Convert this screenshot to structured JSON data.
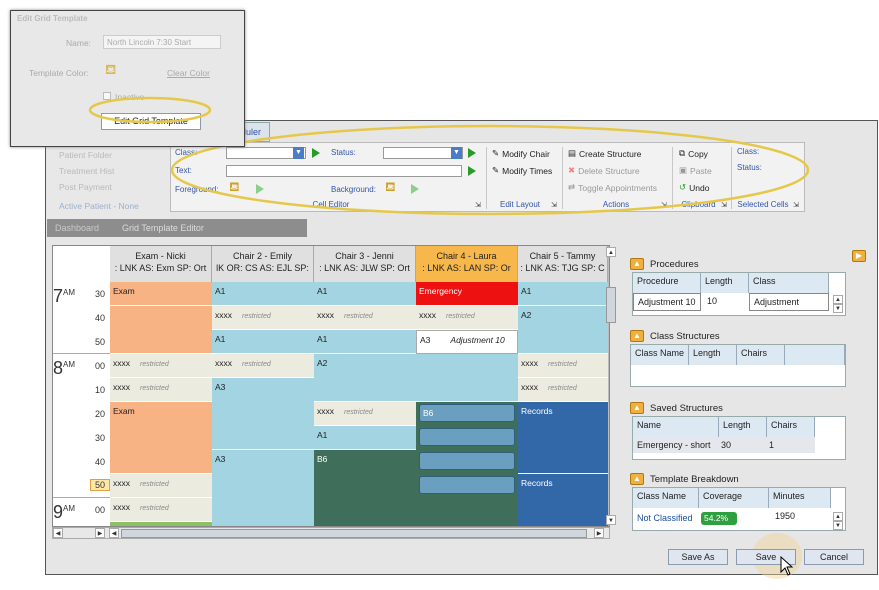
{
  "popup": {
    "title": "Edit Grid Template",
    "name_label": "Name:",
    "name_value": "North Lincoln 7:30 Start",
    "color_label": "Template Color:",
    "clear_color": "Clear Color",
    "inactive_label": "Inactive",
    "button": "Edit Grid Template"
  },
  "tab_scheduler": "duler",
  "left_faded": {
    "items": [
      "Patient Folder",
      "Treatment Hist",
      "Post Payment"
    ],
    "active_patient": "Active Patient - None",
    "tabs": [
      "Dashboard",
      "Grid Template Editor"
    ]
  },
  "ribbon": {
    "class_label": "Class:",
    "status_label": "Status:",
    "text_label": "Text:",
    "foreground_label": "Foreground:",
    "background_label": "Background:",
    "cell_editor": "Cell Editor",
    "modify_chair": "Modify Chair",
    "modify_times": "Modify Times",
    "edit_layout": "Edit Layout",
    "create_structure": "Create Structure",
    "delete_structure": "Delete Structure",
    "toggle_appointments": "Toggle Appointments",
    "actions": "Actions",
    "copy": "Copy",
    "paste": "Paste",
    "undo": "Undo",
    "clipboard": "Clipboard",
    "sc_class": "Class:",
    "sc_status": "Status:",
    "selected_cells": "Selected Cells"
  },
  "grid": {
    "columns": [
      {
        "name": "Exam - Nicki",
        "sub": ": LNK  AS: Exm  SP: Ort"
      },
      {
        "name": "Chair 2 - Emily",
        "sub": "lK  OR: CS  AS: EJL  SP:"
      },
      {
        "name": "Chair 3 - Jenni",
        "sub": ": LNK  AS: JLW  SP: Ort"
      },
      {
        "name": "Chair 4 - Laura",
        "sub": ": LNK  AS: LAN  SP: Or"
      },
      {
        "name": "Chair 5 - Tammy",
        "sub": ": LNK  AS: TJG  SP: C"
      }
    ],
    "hours": [
      {
        "h": "7",
        "ap": "AM"
      },
      {
        "h": "8",
        "ap": "AM"
      },
      {
        "h": "9",
        "ap": "AM"
      }
    ],
    "minutes": [
      "30",
      "40",
      "50",
      "00",
      "10",
      "20",
      "30",
      "40",
      "50",
      "00"
    ],
    "restricted": "restricted",
    "xxxx": "xxxx",
    "labels": {
      "exam": "Exam",
      "a1": "A1",
      "a2": "A2",
      "a3": "A3",
      "b6": "B6",
      "emergency": "Emergency",
      "records": "Records",
      "adjustment": "Adjustment 10"
    }
  },
  "procedures": {
    "title": "Procedures",
    "headers": [
      "Procedure",
      "Length",
      "Class"
    ],
    "row": [
      "Adjustment 10",
      "10",
      "Adjustment"
    ]
  },
  "class_structures": {
    "title": "Class Structures",
    "headers": [
      "Class Name",
      "Length",
      "Chairs"
    ]
  },
  "saved_structures": {
    "title": "Saved Structures",
    "headers": [
      "Name",
      "Length",
      "Chairs"
    ],
    "row": [
      "Emergency - short",
      "30",
      "1"
    ]
  },
  "template_breakdown": {
    "title": "Template Breakdown",
    "headers": [
      "Class Name",
      "Coverage",
      "Minutes"
    ],
    "row": [
      "Not Classified",
      "54.2%",
      "1950"
    ]
  },
  "buttons": {
    "save_as": "Save As",
    "save": "Save",
    "cancel": "Cancel"
  },
  "colors": {
    "orange": "#f7b384",
    "blue": "#a3d4e2",
    "teal": "#3f6f5a",
    "red": "#ee1111",
    "navy": "#3368a8",
    "beige": "#ecebe0",
    "accent": "#e5c84a"
  }
}
